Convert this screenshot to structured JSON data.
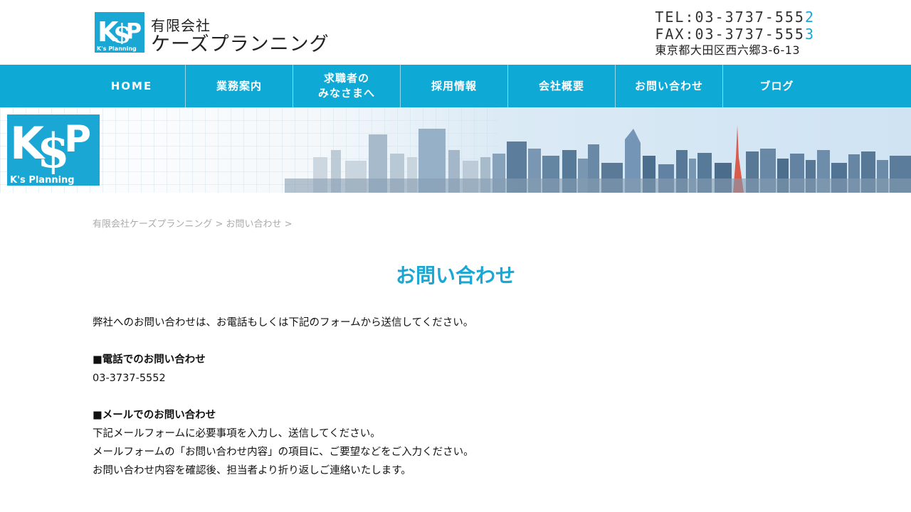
{
  "header": {
    "logo_text": "K's Planning",
    "company_prefix": "有限会社",
    "company_name": "ケーズプランニング",
    "tel_prefix": "TEL:03-3737-555",
    "tel_last": "2",
    "fax_prefix": "FAX:03-3737-555",
    "fax_last": "3",
    "address": "東京都大田区西六郷3-6-13",
    "accent_color": "#1aa7d4"
  },
  "nav": {
    "items": [
      {
        "label": "HOME"
      },
      {
        "label": "業務案内"
      },
      {
        "label_line1": "求職者の",
        "label_line2": "みなさまへ"
      },
      {
        "label": "採用情報"
      },
      {
        "label": "会社概要"
      },
      {
        "label": "お問い合わせ"
      },
      {
        "label": "ブログ"
      }
    ],
    "color": "#0fa9d6"
  },
  "banner": {
    "logo_text": "K's Planning"
  },
  "breadcrumb": {
    "home": "有限会社ケーズプランニング",
    "sep1": " > ",
    "current": "お問い合わせ",
    "sep2": " >"
  },
  "main": {
    "title": "お問い合わせ",
    "intro": "弊社へのお問い合わせは、お電話もしくは下記のフォームから送信してください。",
    "phone_heading": "■電話でのお問い合わせ",
    "phone_number": "03-3737-5552",
    "mail_heading": "■メールでのお問い合わせ",
    "mail_line1": "下記メールフォームに必要事項を入力し、送信してください。",
    "mail_line2": "メールフォームの「お問い合わせ内容」の項目に、ご要望などをご入力ください。",
    "mail_line3": "お問い合わせ内容を確認後、担当者より折り返しご連絡いたします。"
  }
}
